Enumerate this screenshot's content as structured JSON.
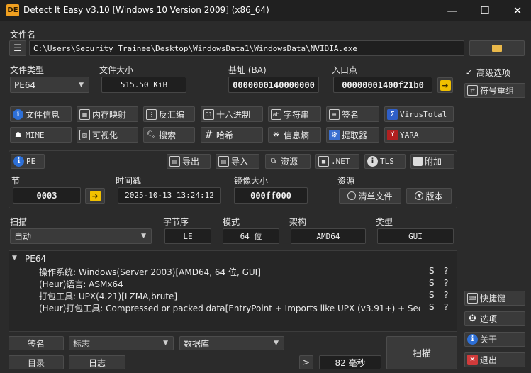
{
  "window": {
    "title": "Detect It Easy v3.10 [Windows 10 Version 2009] (x86_64)",
    "logo_text": "DE",
    "minimize": "—",
    "maximize": "☐",
    "close": "✕"
  },
  "file": {
    "label": "文件名",
    "path": "C:\\Users\\Security Trainee\\Desktop\\WindowsData1\\WindowsData\\NVIDIA.exe"
  },
  "info": {
    "type_label": "文件类型",
    "type_value": "PE64",
    "size_label": "文件大小",
    "size_value": "515.50 KiB",
    "base_label": "基址 (BA)",
    "base_value": "0000000140000000",
    "entry_label": "入口点",
    "entry_value": "00000001400f21b0"
  },
  "tools_row1": [
    "文件信息",
    "内存映射",
    "反汇编",
    "十六进制",
    "字符串",
    "签名",
    "VirusTotal"
  ],
  "tools_row2": [
    "MIME",
    "可视化",
    "搜索",
    "哈希",
    "信息熵",
    "提取器",
    "YARA"
  ],
  "pe_row": {
    "pe": "PE",
    "export": "导出",
    "import": "导入",
    "resources": "资源",
    "net": ".NET",
    "tls": "TLS",
    "overlay": "附加"
  },
  "sections": {
    "label": "节",
    "value": "0003",
    "time_label": "时间戳",
    "time_value": "2025-10-13 13:24:12",
    "image_label": "镜像大小",
    "image_value": "000ff000",
    "res_label": "资源",
    "manifest": "清单文件",
    "version": "版本"
  },
  "scan": {
    "label": "扫描",
    "mode": "自动",
    "endian_label": "字节序",
    "endian": "LE",
    "mode_label": "模式",
    "bits": "64 位",
    "arch_label": "架构",
    "arch": "AMD64",
    "type_label": "类型",
    "type": "GUI"
  },
  "results": {
    "root": "PE64",
    "rows": [
      {
        "text": "操作系统: Windows(Server 2003)[AMD64, 64 位, GUI]",
        "s": "S",
        "q": "?"
      },
      {
        "text": "(Heur)语言: ASMx64",
        "s": "S",
        "q": "?"
      },
      {
        "text": "打包工具: UPX(4.21)[LZMA,brute]",
        "s": "S",
        "q": "?"
      },
      {
        "text": "(Heur)打包工具: Compressed or packed data[EntryPoint + Imports like UPX (v3.91+) + Secti…",
        "s": "S",
        "q": "?"
      }
    ]
  },
  "bottom": {
    "signature": "签名",
    "flags": "标志",
    "database": "数据库",
    "directory": "目录",
    "log": "日志",
    "next": ">",
    "time": "82 毫秒",
    "scan": "扫描"
  },
  "side": {
    "advanced": "高级选项",
    "advanced_checked": "✓",
    "regroup": "符号重组",
    "shortcuts": "快捷键",
    "options": "选项",
    "about": "关于",
    "exit": "退出"
  }
}
